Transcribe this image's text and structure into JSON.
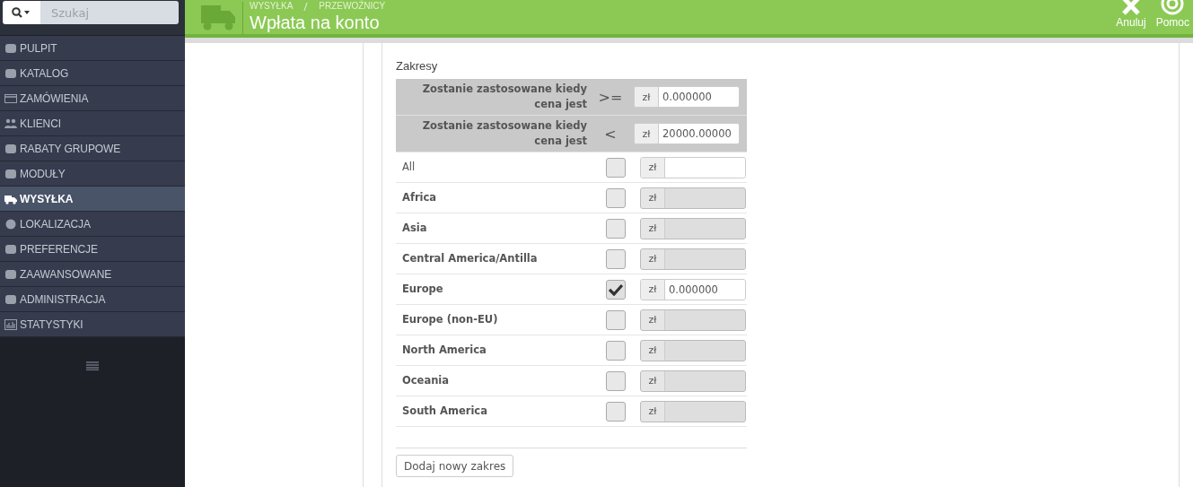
{
  "sidebar": {
    "search": {
      "placeholder": "Szukaj"
    },
    "items": [
      {
        "label": "PULPIT",
        "selected": false
      },
      {
        "label": "KATALOG",
        "selected": false
      },
      {
        "label": "ZAMÓWIENIA",
        "selected": false
      },
      {
        "label": "KLIENCI",
        "selected": false
      },
      {
        "label": "RABATY GRUPOWE",
        "selected": false
      },
      {
        "label": "MODUŁY",
        "selected": false
      },
      {
        "label": "WYSYŁKA",
        "selected": true
      },
      {
        "label": "LOKALIZACJA",
        "selected": false
      },
      {
        "label": "PREFERENCJE",
        "selected": false
      },
      {
        "label": "ZAAWANSOWANE",
        "selected": false
      },
      {
        "label": "ADMINISTRACJA",
        "selected": false
      },
      {
        "label": "STATYSTYKI",
        "selected": false
      }
    ]
  },
  "header": {
    "breadcrumb": [
      "WYSYŁKA",
      "PRZEWOŹNICY"
    ],
    "title": "Wpłata na konto",
    "actions": [
      {
        "label": "Anuluj"
      },
      {
        "label": "Pomoc"
      }
    ]
  },
  "ranges": {
    "title": "Zakresy",
    "conditions": [
      {
        "label": "Zostanie zastosowane kiedy cena jest",
        "operator": ">=",
        "currency": "zł",
        "value": "0.000000"
      },
      {
        "label": "Zostanie zastosowane kiedy cena jest",
        "operator": "<",
        "currency": "zł",
        "value": "20000.00000"
      }
    ],
    "zones": [
      {
        "kind": "all",
        "name": "All",
        "checked": false,
        "disabled": false,
        "currency": "zł"
      },
      {
        "kind": "zone",
        "name": "Africa",
        "checked": false,
        "disabled": true,
        "currency": "zł"
      },
      {
        "kind": "zone",
        "name": "Asia",
        "checked": false,
        "disabled": true,
        "currency": "zł"
      },
      {
        "kind": "zone",
        "name": "Central America/Antilla",
        "checked": false,
        "disabled": true,
        "currency": "zł"
      },
      {
        "kind": "zone",
        "name": "Europe",
        "checked": true,
        "disabled": false,
        "currency": "zł",
        "value": "0.000000"
      },
      {
        "kind": "zone",
        "name": "Europe (non-EU)",
        "checked": false,
        "disabled": true,
        "currency": "zł"
      },
      {
        "kind": "zone",
        "name": "North America",
        "checked": false,
        "disabled": true,
        "currency": "zł"
      },
      {
        "kind": "zone",
        "name": "Oceania",
        "checked": false,
        "disabled": true,
        "currency": "zł"
      },
      {
        "kind": "zone",
        "name": "South America",
        "checked": false,
        "disabled": true,
        "currency": "zł"
      }
    ],
    "add_button": "Dodaj nowy zakres"
  }
}
